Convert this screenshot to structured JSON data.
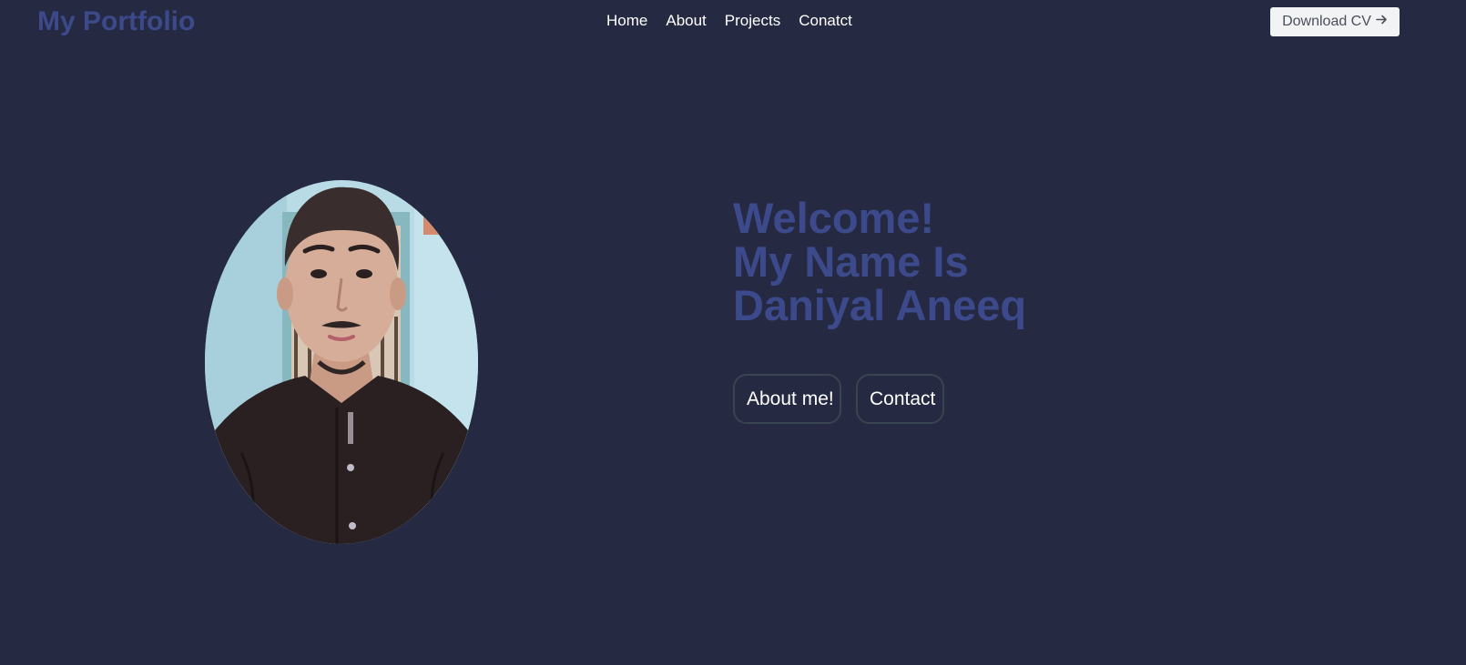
{
  "header": {
    "logo": "My Portfolio",
    "nav": [
      "Home",
      "About",
      "Projects",
      "Conatct"
    ],
    "download_label": "Download CV",
    "download_icon": "arrow-right-icon"
  },
  "hero": {
    "headline": [
      "Welcome!",
      "My Name Is",
      "Daniyal Aneeq"
    ],
    "buttons": [
      "About me!",
      "Contact"
    ]
  },
  "colors": {
    "background": "#252a42",
    "accent": "#3c4a8c",
    "button_border": "#3a4350"
  }
}
